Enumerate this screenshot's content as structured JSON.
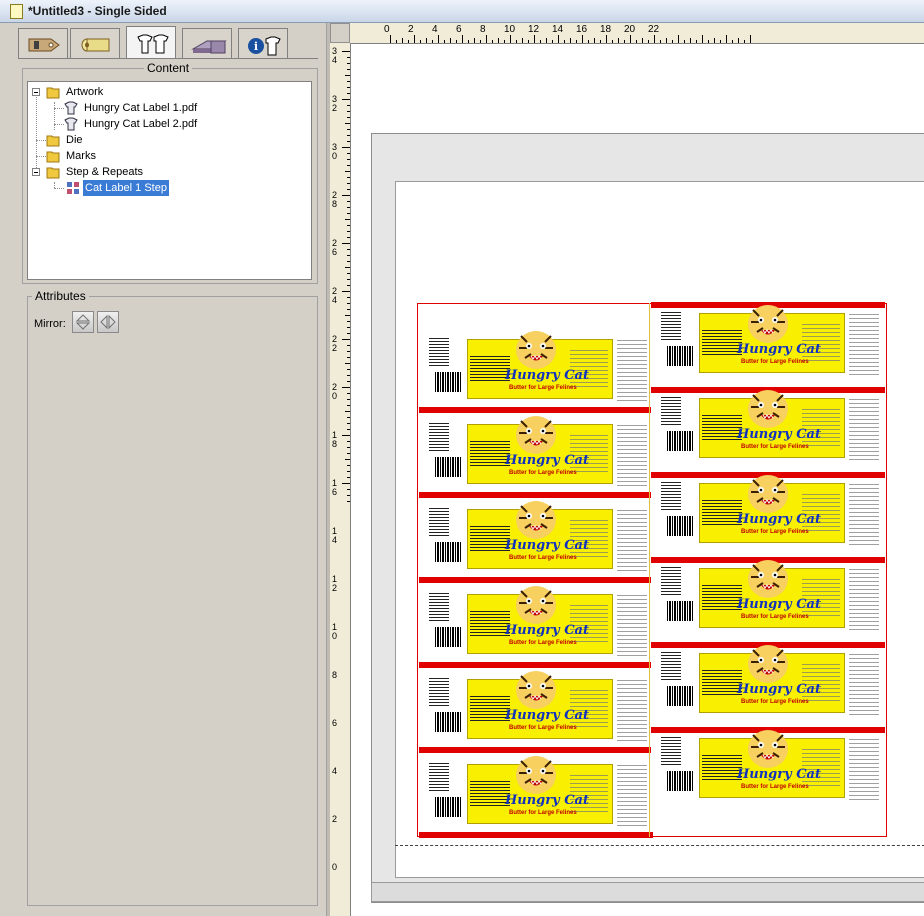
{
  "window": {
    "title": "*Untitled3 - Single Sided"
  },
  "tabs": [
    {
      "icon": "tag-icon"
    },
    {
      "icon": "paper-roll-icon"
    },
    {
      "icon": "content-shirts-icon"
    },
    {
      "icon": "press-icon"
    },
    {
      "icon": "info-shirt-icon"
    }
  ],
  "content": {
    "label": "Content",
    "tree": {
      "artwork": "Artwork",
      "artwork_items": [
        "Hungry Cat Label 1.pdf",
        "Hungry Cat Label 2.pdf"
      ],
      "die": "Die",
      "marks": "Marks",
      "step_repeats": "Step & Repeats",
      "step_items": [
        "Cat Label 1 Step"
      ]
    }
  },
  "attributes": {
    "label": "Attributes",
    "mirror_label": "Mirror:"
  },
  "label": {
    "brand": "Hungry Cat",
    "tagline": "Butter for Large Felines"
  },
  "ruler": {
    "h_labels": [
      "0",
      "2",
      "4",
      "6",
      "8",
      "10",
      "12",
      "14",
      "16",
      "18",
      "20",
      "22"
    ],
    "v_labels": [
      "34",
      "32",
      "30",
      "28",
      "26",
      "24",
      "22",
      "20",
      "18",
      "16",
      "14",
      "12",
      "10",
      "8",
      "6",
      "4",
      "2",
      "0"
    ]
  },
  "colors": {
    "selection": "#3a7bd5",
    "die_line": "#e00000",
    "label_bg": "#f8f000",
    "brand_text": "#1030c0"
  }
}
